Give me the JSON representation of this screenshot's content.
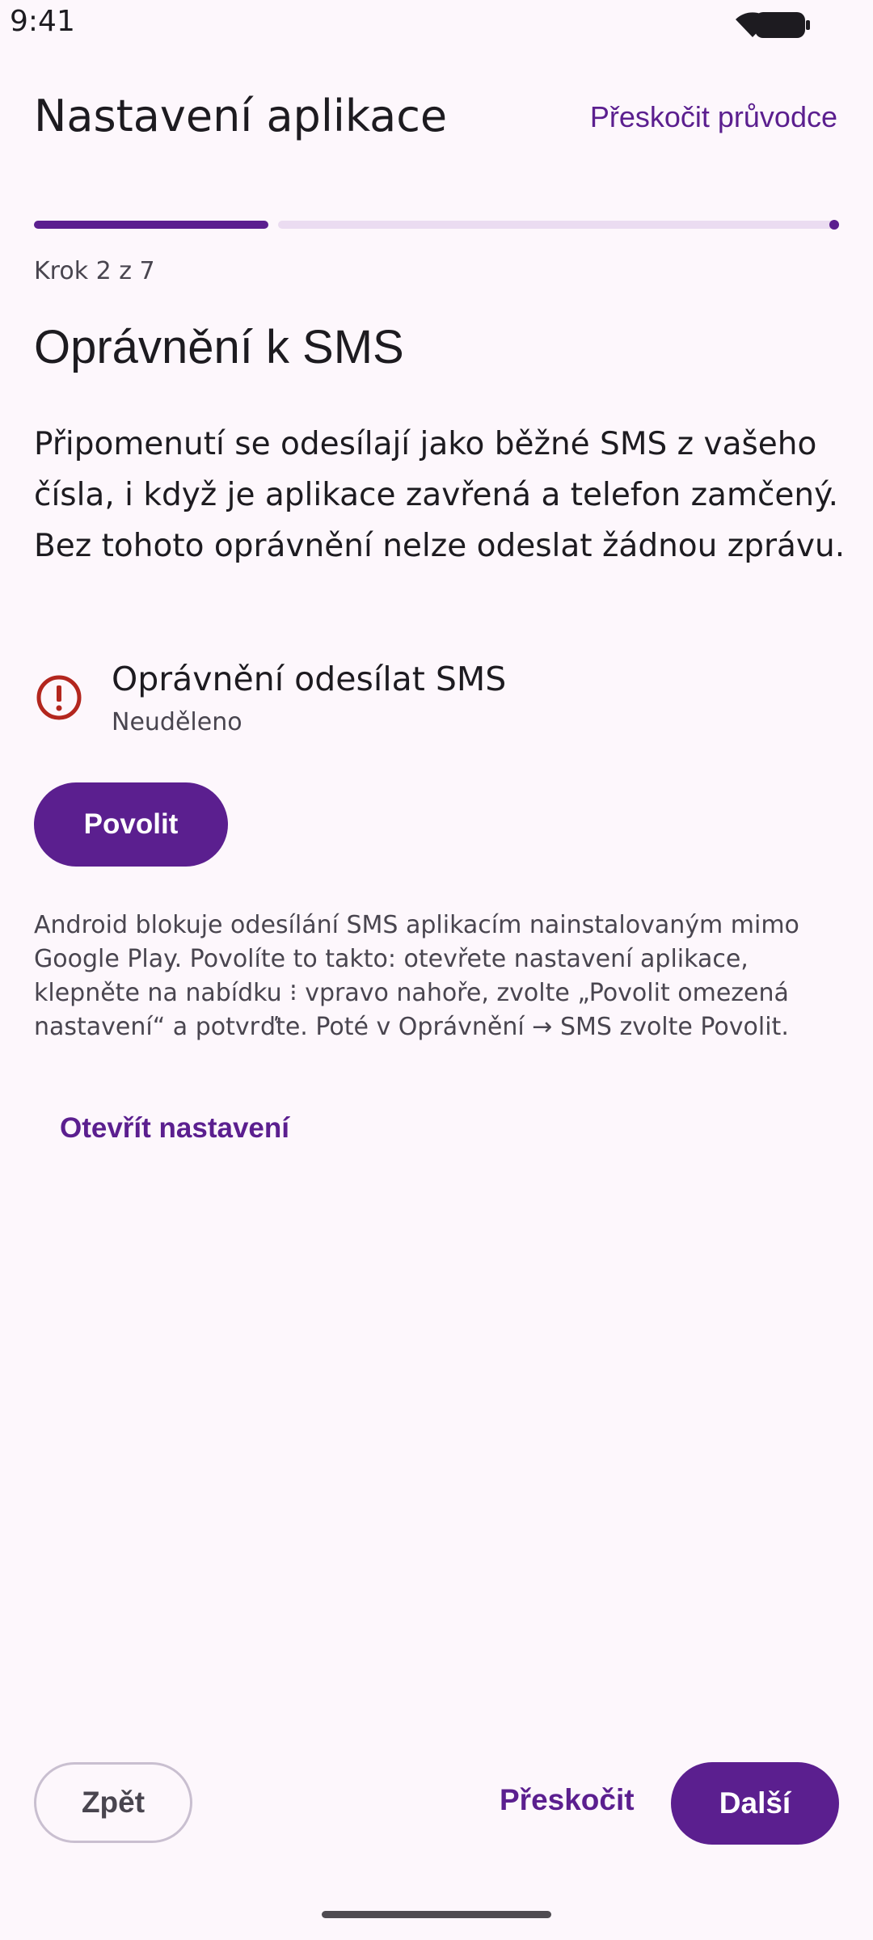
{
  "status_bar": {
    "time": "9:41",
    "icons": [
      "wifi-icon",
      "battery-icon"
    ]
  },
  "header": {
    "title": "Nastavení aplikace",
    "skip_guide_label": "Přeskočit průvodce"
  },
  "progress": {
    "current_step": 2,
    "total_steps": 7,
    "fraction": 0.286,
    "label": "Krok 2 z 7"
  },
  "section": {
    "heading": "Oprávnění k SMS",
    "description": "Připomenutí se odesílají jako běžné SMS z vašeho čísla, i když je aplikace zavřená a telefon zamčený. Bez tohoto oprávnění nelze odeslat žádnou zprávu."
  },
  "permission": {
    "icon": "error-icon",
    "title": "Oprávnění odesílat SMS",
    "status": "Neuděleno",
    "allow_label": "Povolit"
  },
  "help_text": "Android blokuje odesílání SMS aplikacím nainstalovaným mimo Google Play. Povolíte to takto: otevřete nastavení aplikace, klepněte na nabídku ⁝ vpravo nahoře, zvolte „Povolit omezená nastavení“ a potvrďte. Poté v Oprávnění → SMS zvolte Povolit.",
  "open_settings_label": "Otevřít nastavení",
  "footer": {
    "back_label": "Zpět",
    "skip_label": "Přeskočit",
    "next_label": "Další"
  },
  "colors": {
    "accent": "#5b1f8f",
    "background": "#fdf7fc",
    "error": "#b3261e",
    "track": "#ebdcf1"
  }
}
